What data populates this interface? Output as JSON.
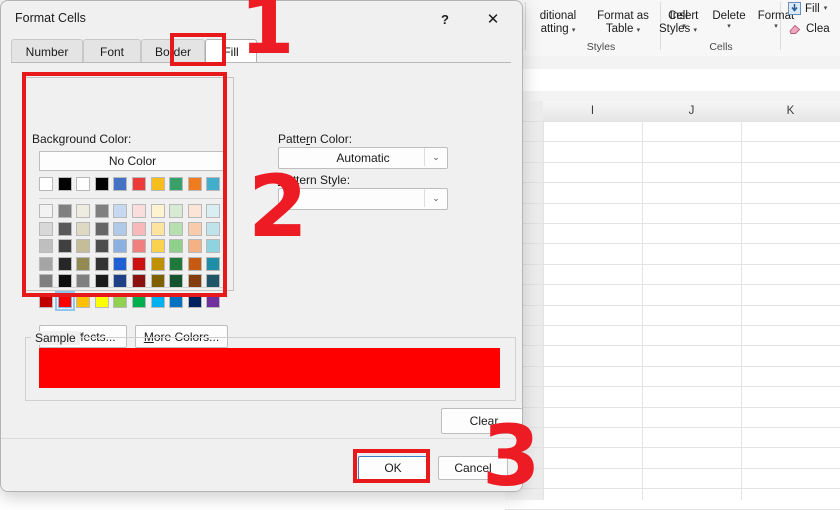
{
  "dialog": {
    "title": "Format Cells",
    "help_icon": "?",
    "close_icon": "✕",
    "tabs": [
      {
        "label": "Number",
        "active": false
      },
      {
        "label": "Font",
        "active": false
      },
      {
        "label": "Border",
        "active": false
      },
      {
        "label": "Fill",
        "active": true
      }
    ],
    "background_color": {
      "label": "Background Color:",
      "no_color_label": "No Color",
      "theme_row": [
        "#ffffff",
        "#000000",
        "#ffffff",
        "#000000",
        "#4472c4",
        "#ed3b3b",
        "#f5bd1e",
        "#38a169",
        "#f07c21",
        "#43aecb"
      ],
      "tint_rows": [
        [
          "#f2f2f2",
          "#808080",
          "#eeece1",
          "#808080",
          "#c6d9f1",
          "#fadddd",
          "#fdf3d0",
          "#d8ead3",
          "#fce4d6",
          "#d9eef3"
        ],
        [
          "#d8d8d8",
          "#595959",
          "#ddd9c3",
          "#666666",
          "#b0c9e8",
          "#f7b9b9",
          "#fce4a0",
          "#b7dfb0",
          "#f8cbad",
          "#bfe3ea"
        ],
        [
          "#bfbfbf",
          "#404040",
          "#c4bd97",
          "#4d4d4d",
          "#8cb0e0",
          "#f08080",
          "#fbd24e",
          "#8fd08a",
          "#f4b183",
          "#8ed3e0"
        ],
        [
          "#a5a5a5",
          "#262626",
          "#938953",
          "#333333",
          "#1f5fd6",
          "#cc1111",
          "#bf9000",
          "#1e7a3c",
          "#c55a11",
          "#1f8fa8"
        ],
        [
          "#7f7f7f",
          "#0d0d0d",
          "#7f7f7f",
          "#1a1a1a",
          "#1f3f86",
          "#8b1111",
          "#7f6000",
          "#14532d",
          "#833c0c",
          "#1f5566"
        ]
      ],
      "standard_row": [
        "#c00000",
        "#ff0000",
        "#ffc000",
        "#ffff00",
        "#92d050",
        "#00b050",
        "#00b0f0",
        "#0070c0",
        "#002060",
        "#7030a0"
      ],
      "selected_standard_index": 1,
      "fill_effects_label": "Fill Effects...",
      "fill_effects_accel": "i",
      "more_colors_label": "More Colors...",
      "more_colors_accel": "M"
    },
    "pattern_color": {
      "label": "Pattern Color:",
      "value": "Automatic",
      "arrow": "⌄"
    },
    "pattern_style": {
      "label": "Pattern Style:",
      "value": "",
      "arrow": "⌄"
    },
    "sample": {
      "label": "Sample",
      "fill_color": "#ff0000"
    },
    "buttons": {
      "clear": "Clear",
      "ok": "OK",
      "cancel": "Cancel"
    }
  },
  "annotations": [
    {
      "number": "1"
    },
    {
      "number": "2"
    },
    {
      "number": "3"
    }
  ],
  "excel": {
    "ribbon": {
      "styles_group": {
        "label": "Styles",
        "items": [
          {
            "line1": "ditional",
            "line2": "atting",
            "caret": "▾"
          },
          {
            "line1": "Format as",
            "line2": "Table",
            "caret": "▾"
          },
          {
            "line1": "Cell",
            "line2": "Styles",
            "caret": "▾"
          }
        ]
      },
      "cells_group": {
        "label": "Cells",
        "items": [
          {
            "line1": "Insert",
            "caret": "▾"
          },
          {
            "line1": "Delete",
            "caret": "▾"
          },
          {
            "line1": "Format",
            "caret": "▾"
          }
        ]
      },
      "editing_group": {
        "items": [
          {
            "label": "Fill",
            "icon": "fill-icon",
            "caret": "▾"
          },
          {
            "label": "Clea",
            "icon": "clear-eraser-icon"
          }
        ]
      }
    },
    "grid": {
      "columns": [
        "I",
        "J",
        "K"
      ],
      "visible_row_count": 19
    }
  }
}
